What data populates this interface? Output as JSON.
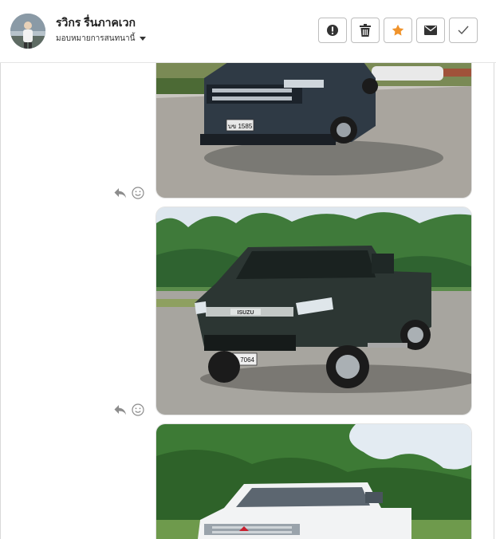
{
  "contact": {
    "name": "รวิกร รื่นภาคเวก",
    "assign_label": "มอบหมายการสนทนานี้"
  },
  "actions": [
    {
      "icon": "alert-icon"
    },
    {
      "icon": "trash-icon"
    },
    {
      "icon": "star-icon",
      "color": "#f0932b"
    },
    {
      "icon": "envelope-icon"
    },
    {
      "icon": "check-icon"
    }
  ],
  "messages": [
    {
      "type": "image",
      "description": "Dark grey Mitsubishi Triton pickup, plate บข 1585",
      "plate": "บข 1585"
    },
    {
      "type": "image",
      "description": "Dark green Isuzu D-Max pickup, plate บล 7064",
      "plate": "บล 7064",
      "badge": "ISUZU"
    },
    {
      "type": "image",
      "description": "White Mitsubishi Triton pickup in front of trees"
    }
  ]
}
